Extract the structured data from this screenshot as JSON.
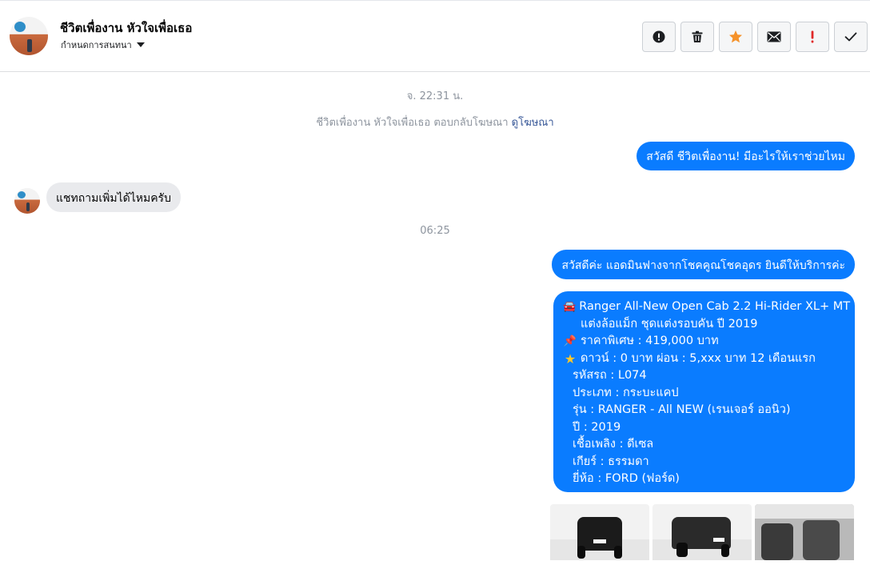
{
  "header": {
    "contact_name": "ชีวิตเพื่องาน หัวใจเพื่อเธอ",
    "conversation_settings": "กำหนดการสนทนา"
  },
  "toolbar": {
    "buttons": [
      {
        "icon": "alert-circle-icon",
        "color": "#1c1e21"
      },
      {
        "icon": "trash-icon",
        "color": "#1c1e21"
      },
      {
        "icon": "star-icon",
        "color": "#f5922a"
      },
      {
        "icon": "envelope-icon",
        "color": "#1c1e21"
      },
      {
        "icon": "exclamation-icon",
        "color": "#e02828"
      },
      {
        "icon": "check-icon",
        "color": "#1c1e21"
      }
    ]
  },
  "chat": {
    "time1": "จ. 22:31 น.",
    "ad_reply_text": "ชีวิตเพื่องาน หัวใจเพื่อเธอ ตอบกลับโฆษณา",
    "ad_reply_link": "ดูโฆษณา",
    "msg1": "สวัสดี ชีวิตเพื่องาน! มีอะไรให้เราช่วยไหม",
    "msg2": "แชทถามเพิ่มได้ไหมครับ",
    "time2": "06:25",
    "msg3": "สวัสดีค่ะ แอดมินฟางจากโชคคูณโชคอุดร ยินดีให้บริการค่ะ",
    "listing": {
      "title": "Ranger All-New Open Cab 2.2 Hi-Rider XL+ MT",
      "subtitle": "แต่งล้อแม็ก ชุดแต่งรอบคัน ปี 2019",
      "price": "ราคาพิเศษ : 419,000 บาท",
      "down": "ดาวน์ : 0 บาท ผ่อน : 5,xxx บาท 12 เดือนแรก",
      "code": "รหัสรถ : L074",
      "type": "ประเภท : กระบะแคป",
      "model": "รุ่น : RANGER - All NEW (เรนเจอร์ ออนิว)",
      "year": "ปี : 2019",
      "fuel": "เชื้อเพลิง : ดีเซล",
      "gear": "เกียร์ : ธรรมดา",
      "brand": "ยี่ห้อ : FORD (ฟอร์ด)",
      "emoji_car": "🚘",
      "emoji_pin": "📌",
      "emoji_star": "★"
    }
  },
  "colors": {
    "outgoing_bubble": "#0a7cff",
    "incoming_bubble": "#e9eaed",
    "meta_text": "#8d949e",
    "link": "#385898"
  }
}
